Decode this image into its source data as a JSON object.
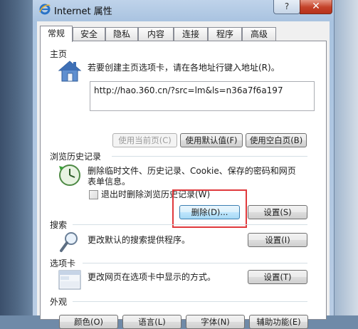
{
  "window": {
    "title": "Internet 属性",
    "help_label": "?",
    "close_label": "✕"
  },
  "tabs": [
    {
      "label": "常规",
      "active": true
    },
    {
      "label": "安全",
      "active": false
    },
    {
      "label": "隐私",
      "active": false
    },
    {
      "label": "内容",
      "active": false
    },
    {
      "label": "连接",
      "active": false
    },
    {
      "label": "程序",
      "active": false
    },
    {
      "label": "高级",
      "active": false
    }
  ],
  "homepage": {
    "heading": "主页",
    "description": "若要创建主页选项卡，请在各地址行键入地址(R)。",
    "url": "http://hao.360.cn/?src=lm&ls=n36a7f6a197",
    "use_current_label": "使用当前页(C)",
    "use_default_label": "使用默认值(F)",
    "use_blank_label": "使用空白页(B)"
  },
  "history": {
    "heading": "浏览历史记录",
    "description_line1": "删除临时文件、历史记录、Cookie、保存的密码和网页",
    "description_line2": "表单信息。",
    "checkbox_label": "退出时删除浏览历史记录(W)",
    "checkbox_checked": false,
    "delete_label": "删除(D)...",
    "settings_label": "设置(S)"
  },
  "search": {
    "heading": "搜索",
    "description": "更改默认的搜索提供程序。",
    "settings_label": "设置(I)"
  },
  "tabs_section": {
    "heading": "选项卡",
    "description": "更改网页在选项卡中显示的方式。",
    "settings_label": "设置(T)"
  },
  "appearance": {
    "heading": "外观",
    "colors_label": "颜色(O)",
    "languages_label": "语言(L)",
    "fonts_label": "字体(N)",
    "accessibility_label": "辅助功能(E)"
  },
  "colors": {
    "highlight": "#e0393c",
    "title_bar": "#b8cce4",
    "close_button": "#c4432a"
  },
  "icons": {
    "title": "ie-logo-icon",
    "homepage": "house-icon",
    "history": "clock-refresh-icon",
    "search": "magnifier-icon",
    "tabs": "tabbed-window-icon"
  }
}
